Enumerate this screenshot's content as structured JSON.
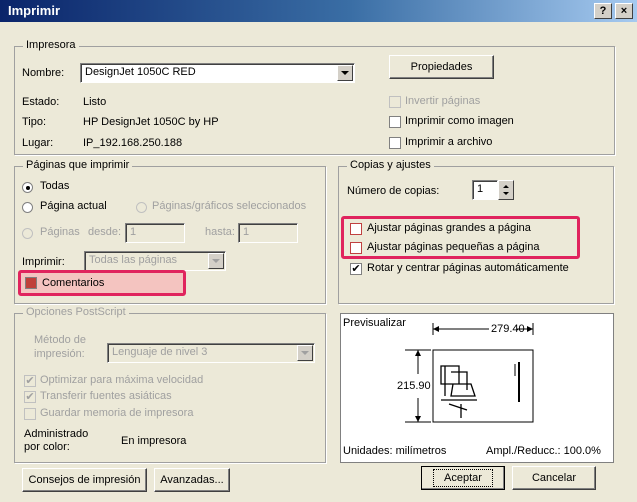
{
  "window": {
    "title": "Imprimir",
    "help_label": "?",
    "close_label": "×"
  },
  "printer": {
    "legend": "Impresora",
    "name_label": "Nombre:",
    "name_value": "DesignJet 1050C RED",
    "properties_button": "Propiedades",
    "status_label": "Estado:",
    "status_value": "Listo",
    "type_label": "Tipo:",
    "type_value": "HP DesignJet 1050C by HP",
    "location_label": "Lugar:",
    "location_value": "IP_192.168.250.188",
    "invert_pages": "Invertir páginas",
    "print_as_image": "Imprimir como imagen",
    "print_to_file": "Imprimir a archivo"
  },
  "pages": {
    "legend": "Páginas que imprimir",
    "all": "Todas",
    "current_page": "Página actual",
    "selected_pages": "Páginas/gráficos seleccionados",
    "pages_label": "Páginas",
    "from_label": "desde:",
    "from_value": "1",
    "to_label": "hasta:",
    "to_value": "1",
    "print_label": "Imprimir:",
    "print_value": "Todas las páginas",
    "comments": "Comentarios"
  },
  "copies": {
    "legend": "Copias y ajustes",
    "copies_label": "Número de copias:",
    "copies_value": "1",
    "fit_large": "Ajustar páginas grandes a página",
    "fit_small": "Ajustar páginas pequeñas a página",
    "rotate_center": "Rotar y centrar páginas automáticamente"
  },
  "postscript": {
    "legend": "Opciones PostScript",
    "method_label_1": "Método de",
    "method_label_2": "impresión:",
    "method_value": "Lenguaje de nivel 3",
    "optimize_speed": "Optimizar para máxima velocidad",
    "transfer_fonts": "Transferir fuentes asiáticas",
    "save_memory": "Guardar memoria de impresora",
    "color_managed_1": "Administrado",
    "color_managed_2": "por color:",
    "color_managed_value": "En impresora"
  },
  "preview": {
    "label": "Previsualizar",
    "width_dim": "279.40",
    "height_dim": "215.90",
    "units": "Unidades: milímetros",
    "scale": "Ampl./Reducc.: 100.0%"
  },
  "buttons": {
    "tips": "Consejos de impresión",
    "advanced": "Avanzadas...",
    "ok": "Aceptar",
    "cancel": "Cancelar"
  },
  "colors": {
    "highlight": "#e0245e",
    "title_gradient_start": "#0a246a"
  }
}
